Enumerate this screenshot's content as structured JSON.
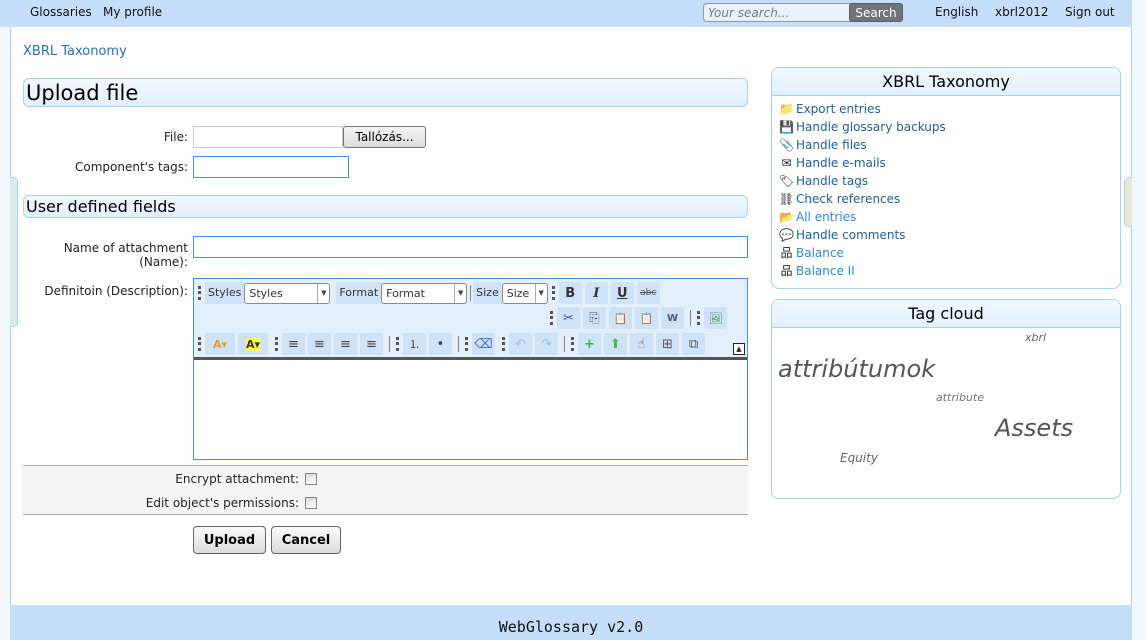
{
  "topbar": {
    "nav": [
      "Glossaries",
      "My profile"
    ],
    "search_placeholder": "Your search...",
    "search_button": "Search",
    "language": "English",
    "username": "xbrl2012",
    "sign_out": "Sign out"
  },
  "breadcrumb": "XBRL Taxonomy",
  "upload": {
    "title": "Upload file",
    "file_label": "File:",
    "browse_button": "Tallózás...",
    "file_value": "",
    "tags_label": "Component's tags:",
    "tags_value": ""
  },
  "udf": {
    "title": "User defined fields",
    "name_label_1": "Name of attachment",
    "name_label_2": "(Name):",
    "name_value": "",
    "desc_label": "Definitoin (Description):"
  },
  "editor": {
    "styles_label": "Styles",
    "styles_value": "Styles",
    "format_label": "Format",
    "format_value": "Format",
    "size_label": "Size",
    "size_value": "Size",
    "buttons_row1": [
      {
        "name": "bold",
        "glyph": "B"
      },
      {
        "name": "italic",
        "glyph": "I"
      },
      {
        "name": "underline",
        "glyph": "U"
      },
      {
        "name": "strikethrough",
        "glyph": "abc"
      }
    ],
    "buttons_row2": [
      {
        "name": "cut",
        "glyph": "✂"
      },
      {
        "name": "copy",
        "glyph": "⎘"
      },
      {
        "name": "paste",
        "glyph": "📋"
      },
      {
        "name": "paste-text",
        "glyph": "📋"
      },
      {
        "name": "paste-word",
        "glyph": "W"
      },
      {
        "name": "image",
        "glyph": "🖼"
      }
    ],
    "buttons_row3": [
      {
        "name": "text-color",
        "glyph": "A▾"
      },
      {
        "name": "bg-color",
        "glyph": "A▾"
      },
      {
        "name": "align-left",
        "glyph": "≡"
      },
      {
        "name": "align-center",
        "glyph": "≡"
      },
      {
        "name": "align-right",
        "glyph": "≡"
      },
      {
        "name": "justify",
        "glyph": "≡"
      },
      {
        "name": "numbered-list",
        "glyph": "⒈"
      },
      {
        "name": "bulleted-list",
        "glyph": "•"
      },
      {
        "name": "remove-format",
        "glyph": "⌫"
      },
      {
        "name": "undo",
        "glyph": "↶"
      },
      {
        "name": "redo",
        "glyph": "↷"
      },
      {
        "name": "new-page",
        "glyph": "+"
      },
      {
        "name": "upload",
        "glyph": "⬆"
      },
      {
        "name": "select",
        "glyph": "☝"
      },
      {
        "name": "insert-template",
        "glyph": "⊞"
      },
      {
        "name": "show-blocks",
        "glyph": "⧉"
      }
    ]
  },
  "options": {
    "encrypt_label": "Encrypt attachment:",
    "encrypt_checked": false,
    "permissions_label": "Edit object's permissions:",
    "permissions_checked": false
  },
  "actions": {
    "upload": "Upload",
    "cancel": "Cancel"
  },
  "sidebar": {
    "title": "XBRL Taxonomy",
    "items": [
      {
        "label": "Export entries",
        "icon": "export-icon",
        "glyph": "📁",
        "color": "#1f5ea8"
      },
      {
        "label": "Handle glossary backups",
        "icon": "backup-icon",
        "glyph": "💾",
        "color": "#1f5ea8"
      },
      {
        "label": "Handle files",
        "icon": "paperclip-icon",
        "glyph": "📎",
        "color": "#1f5ea8"
      },
      {
        "label": "Handle e-mails",
        "icon": "envelope-icon",
        "glyph": "✉",
        "color": "#1f5ea8"
      },
      {
        "label": "Handle tags",
        "icon": "tag-icon",
        "glyph": "🏷",
        "color": "#1f5ea8"
      },
      {
        "label": "Check references",
        "icon": "broken-link-icon",
        "glyph": "⛓",
        "color": "#1f5ea8"
      },
      {
        "label": "All entries",
        "icon": "folder-icon",
        "glyph": "📂",
        "color": "#2c8ae0"
      },
      {
        "label": "Handle comments",
        "icon": "comment-icon",
        "glyph": "💬",
        "color": "#1f5ea8"
      },
      {
        "label": "Balance",
        "icon": "hierarchy-icon",
        "glyph": "品",
        "color": "#2c8ae0"
      },
      {
        "label": "Balance II",
        "icon": "hierarchy-icon",
        "glyph": "品",
        "color": "#2c8ae0"
      }
    ]
  },
  "tag_cloud": {
    "title": "Tag cloud",
    "tags": [
      {
        "label": "xbrl",
        "weight": 1
      },
      {
        "label": "attribútumok",
        "weight": 4
      },
      {
        "label": "attribute",
        "weight": 1
      },
      {
        "label": "Assets",
        "weight": 4
      },
      {
        "label": "Equity",
        "weight": 1
      }
    ]
  },
  "footer": "WebGlossary v2.0"
}
